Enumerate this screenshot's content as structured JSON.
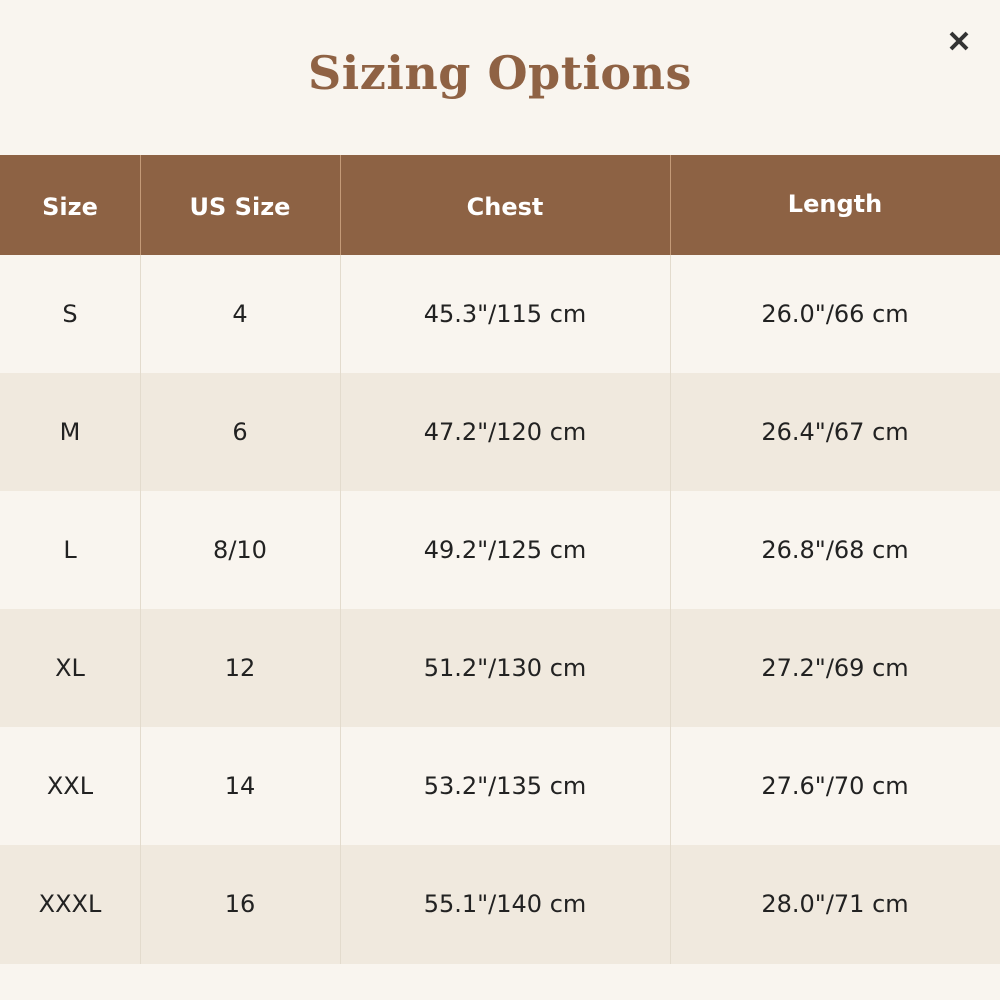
{
  "dialog": {
    "title": "Sizing Options",
    "close_icon": "close-icon"
  },
  "table": {
    "columns": [
      "Size",
      "US Size",
      "Chest",
      "Length"
    ],
    "rows": [
      [
        "S",
        "4",
        "45.3\"/115 cm",
        "26.0\"/66 cm"
      ],
      [
        "M",
        "6",
        "47.2\"/120 cm",
        "26.4\"/67 cm"
      ],
      [
        "L",
        "8/10",
        "49.2\"/125 cm",
        "26.8\"/68 cm"
      ],
      [
        "XL",
        "12",
        "51.2\"/130 cm",
        "27.2\"/69 cm"
      ],
      [
        "XXL",
        "14",
        "53.2\"/135 cm",
        "27.6\"/70 cm"
      ],
      [
        "XXXL",
        "16",
        "55.1\"/140 cm",
        "28.0\"/71 cm"
      ]
    ]
  },
  "colors": {
    "background": "#f9f5ef",
    "accent": "#8d6244",
    "title_text": "#8f6244",
    "row_alt": "#f0e9de",
    "header_text": "#ffffff",
    "cell_text": "#222222"
  }
}
